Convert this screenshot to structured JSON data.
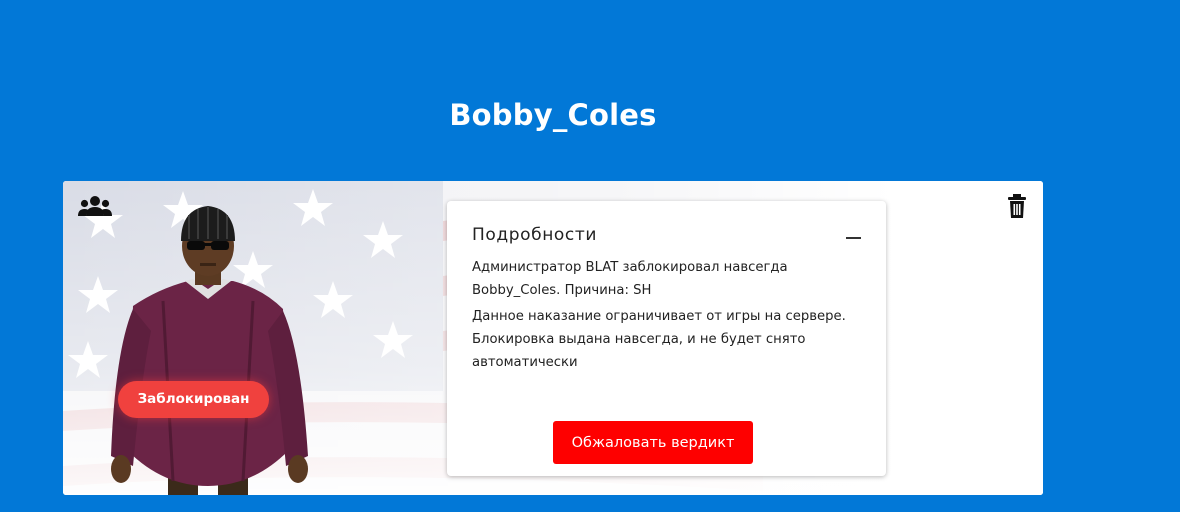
{
  "player": {
    "name": "Bobby_Coles"
  },
  "card": {
    "status_badge": "Заблокирован",
    "details": {
      "title": "Подробности",
      "summary": "Администратор BLAT заблокировал навсегда Bobby_Coles. Причина: SH",
      "description": "Данное наказание ограничивает от игры на сервере. Блокировка выдана навсегда, и не будет снято автоматически",
      "appeal_button": "Обжаловать вердикт"
    }
  },
  "icons": {
    "top_left": "users-group-icon",
    "top_right": "trash-icon",
    "details_toggle": "minus-icon"
  },
  "colors": {
    "page_background": "#0278d7",
    "badge": "#f0413e",
    "appeal_button": "#fe0000",
    "card": "#ffffff"
  }
}
